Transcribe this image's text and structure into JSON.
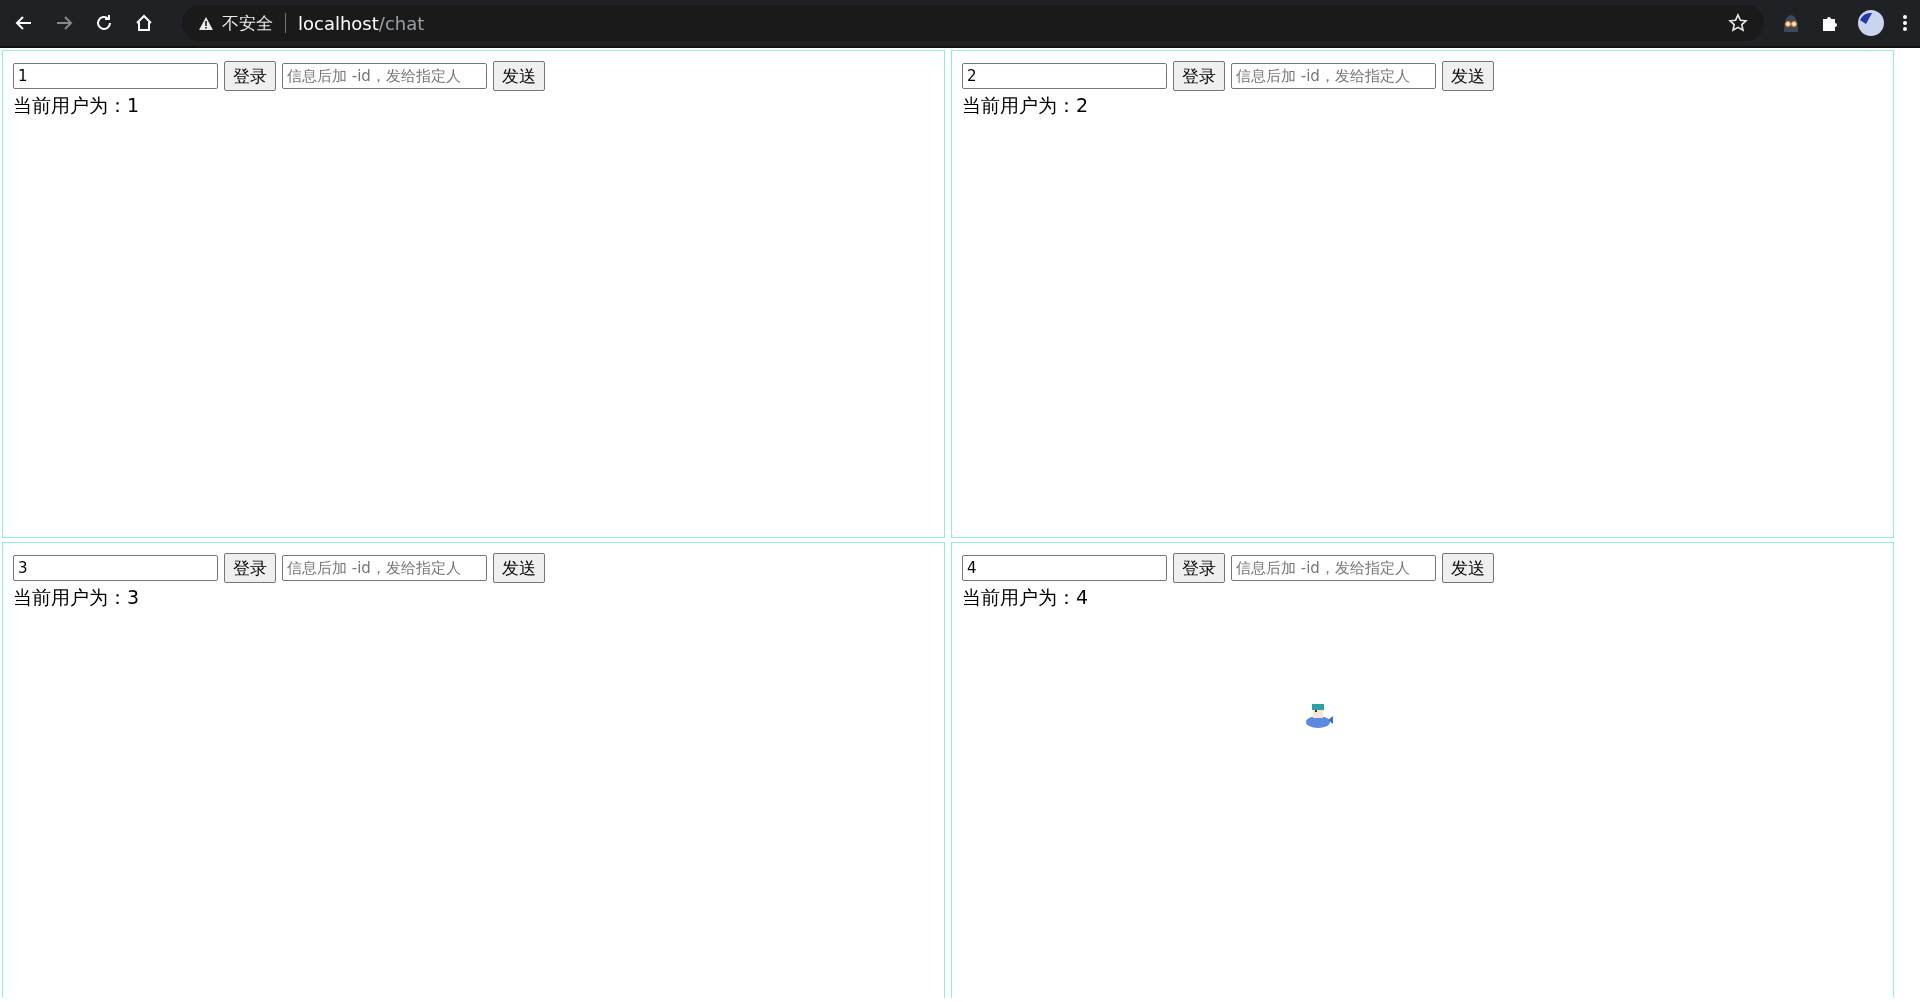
{
  "browser": {
    "security_label": "不安全",
    "url_host": "localhost",
    "url_path": "/chat"
  },
  "panels": [
    {
      "user_field": "1",
      "login_button": "登录",
      "message_placeholder": "信息后加 -id，发给指定人",
      "send_button": "发送",
      "current_user": "当前用户为：1",
      "sprite": false
    },
    {
      "user_field": "2",
      "login_button": "登录",
      "message_placeholder": "信息后加 -id，发给指定人",
      "send_button": "发送",
      "current_user": "当前用户为：2",
      "sprite": false
    },
    {
      "user_field": "3",
      "login_button": "登录",
      "message_placeholder": "信息后加 -id，发给指定人",
      "send_button": "发送",
      "current_user": "当前用户为：3",
      "sprite": false
    },
    {
      "user_field": "4",
      "login_button": "登录",
      "message_placeholder": "信息后加 -id，发给指定人",
      "send_button": "发送",
      "current_user": "当前用户为：4",
      "sprite": true
    }
  ]
}
